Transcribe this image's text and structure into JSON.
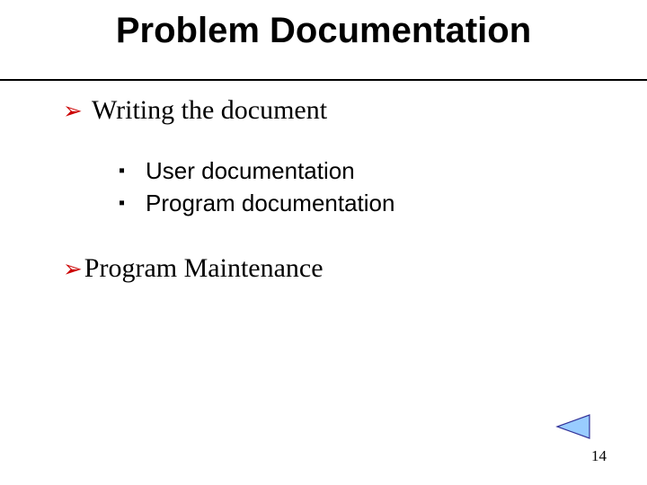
{
  "title": "Problem Documentation",
  "bullets": {
    "arrow_glyph": "➢",
    "square_glyph": "▪",
    "level1": [
      {
        "text": "Writing the document"
      },
      {
        "text": "Program Maintenance"
      }
    ],
    "level2_group0": [
      {
        "text": "User documentation"
      },
      {
        "text": "Program documentation"
      }
    ]
  },
  "nav": {
    "back_fill": "#99ccff",
    "back_stroke": "#333399"
  },
  "page_number": "14"
}
